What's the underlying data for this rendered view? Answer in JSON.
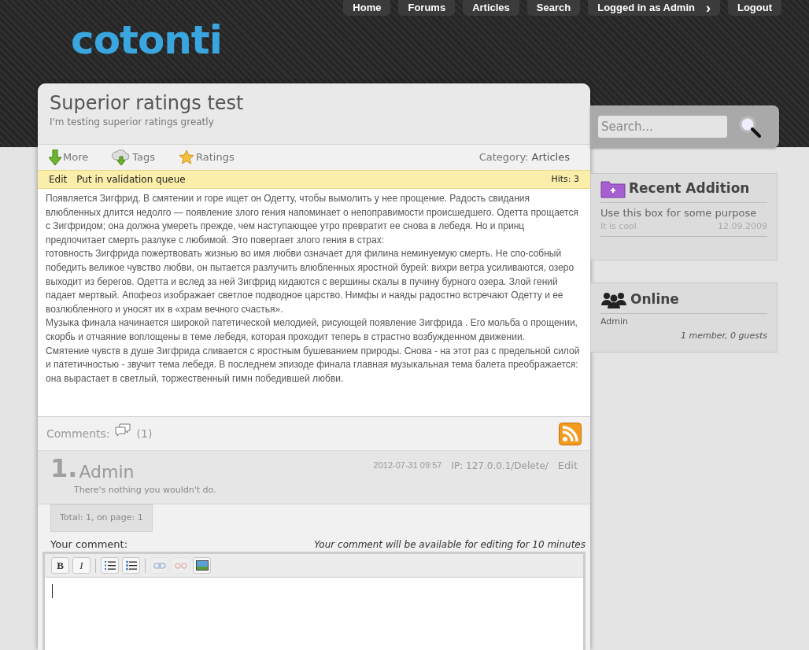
{
  "nav": [
    {
      "label": "Home"
    },
    {
      "label": "Forums"
    },
    {
      "label": "Articles"
    },
    {
      "label": "Search"
    },
    {
      "label": "Logged in as Admin",
      "chevron": "›"
    },
    {
      "label": "Logout"
    }
  ],
  "logo": "cotonti",
  "article": {
    "title": "Superior ratings test",
    "subtitle": "I'm testing superior ratings greatly",
    "actions": [
      {
        "kind": "more",
        "label": "More"
      },
      {
        "kind": "tags",
        "label": "Tags"
      },
      {
        "kind": "ratings",
        "label": "Ratings"
      }
    ],
    "category_label": "Category:",
    "category": "Articles",
    "admin_links": [
      "Edit",
      "Put in validation queue"
    ],
    "hits": "Hits: 3",
    "paragraphs": [
      "Появляется Зигфрид. В смятении и горе ищет он Одетту, чтобы вымолить у нее прощение. Радость свидания влюбленных длится недолго — появление злого гения напоминает о непоправимости происшедшего. Одетта прощается с Зигфридом; она должна умереть прежде, чем наступающее утро превратит ее снова в лебедя. Но и принц предпочитает смерть разлуке с любимой. Это повергает злого гения в страх:",
      "готовность Зигфрида пожертвовать жизнью во имя любви означает для филина неминуемую смерть. Не спо-собный победить великое чувство любви, он пытается разлучить влюбленных яростной бурей: вихри ветра усиливаются, озеро выходит из берегов. Одетта и вслед за ней Зигфрид кидаются с вершины скалы в пучину бурного озера. Злой гений падает мертвый. Апофеоз изображает светлое подводное царство. Нимфы и наяды радостно встречают Одетту и ее возлюбленного и уносят их в «храм вечного счастья».",
      "Музыка финала начинается широкой патетической мелодией, рисующей появление Зигфрида . Его мольба о прощении, скорбь и отчаяние воплощены в теме лебедя, которая проходит теперь в страстно возбужденном движении.",
      "Смятение чувств в душе Зигфрида сливается с яростным бушеванием природы. Снова - на этот раз с предельной силой и патетичностью - звучит тема лебедя. В последнем эпизоде финала главная музыкальная тема балета преображается: она вырастает в светлый, торжественный гимн победившей любви."
    ]
  },
  "comments": {
    "label": "Comments:",
    "count": "(1)",
    "items": [
      {
        "number": "1.",
        "author": "Admin",
        "date": "2012-07-31 09:57",
        "ip": "IP: 127.0.0.1/Delete/",
        "edit": "Edit",
        "text": "There's nothing you wouldn't do."
      }
    ],
    "total": "Total: 1, on page: 1",
    "form_label": "Your comment:",
    "form_note": "Your comment will be available for editing for 10 minutes",
    "toolbar": [
      {
        "kind": "bold",
        "label": "B"
      },
      {
        "kind": "italic",
        "label": "I"
      },
      {
        "kind": "sep"
      },
      {
        "kind": "ordered-list"
      },
      {
        "kind": "bullet-list"
      },
      {
        "kind": "sep"
      },
      {
        "kind": "link",
        "disabled": true
      },
      {
        "kind": "unlink",
        "disabled": true
      },
      {
        "kind": "image"
      }
    ]
  },
  "sidebar": {
    "search_placeholder": "Search...",
    "recent": {
      "title": "Recent Addition",
      "item_title": "Use this box for some purpose",
      "item_desc": "It is cool",
      "item_date": "12.09.2009"
    },
    "online": {
      "title": "Online",
      "users": [
        "Admin"
      ],
      "summary": "1 member, 0 guests"
    }
  }
}
